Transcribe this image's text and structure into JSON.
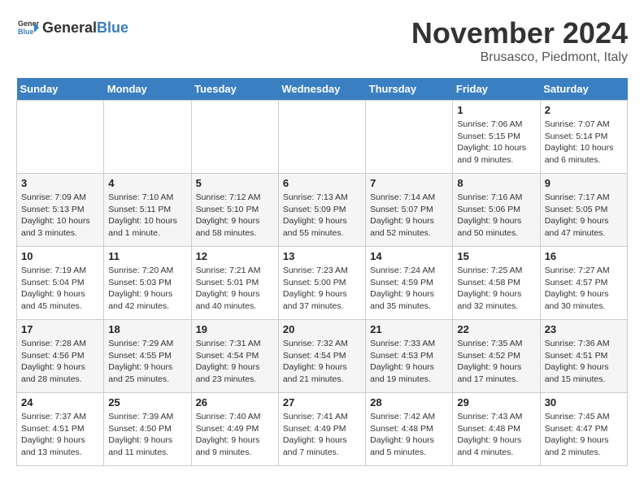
{
  "logo": {
    "text_general": "General",
    "text_blue": "Blue"
  },
  "header": {
    "month_title": "November 2024",
    "location": "Brusasco, Piedmont, Italy"
  },
  "weekdays": [
    "Sunday",
    "Monday",
    "Tuesday",
    "Wednesday",
    "Thursday",
    "Friday",
    "Saturday"
  ],
  "weeks": [
    [
      {
        "day": "",
        "detail": ""
      },
      {
        "day": "",
        "detail": ""
      },
      {
        "day": "",
        "detail": ""
      },
      {
        "day": "",
        "detail": ""
      },
      {
        "day": "",
        "detail": ""
      },
      {
        "day": "1",
        "detail": "Sunrise: 7:06 AM\nSunset: 5:15 PM\nDaylight: 10 hours\nand 9 minutes."
      },
      {
        "day": "2",
        "detail": "Sunrise: 7:07 AM\nSunset: 5:14 PM\nDaylight: 10 hours\nand 6 minutes."
      }
    ],
    [
      {
        "day": "3",
        "detail": "Sunrise: 7:09 AM\nSunset: 5:13 PM\nDaylight: 10 hours\nand 3 minutes."
      },
      {
        "day": "4",
        "detail": "Sunrise: 7:10 AM\nSunset: 5:11 PM\nDaylight: 10 hours\nand 1 minute."
      },
      {
        "day": "5",
        "detail": "Sunrise: 7:12 AM\nSunset: 5:10 PM\nDaylight: 9 hours\nand 58 minutes."
      },
      {
        "day": "6",
        "detail": "Sunrise: 7:13 AM\nSunset: 5:09 PM\nDaylight: 9 hours\nand 55 minutes."
      },
      {
        "day": "7",
        "detail": "Sunrise: 7:14 AM\nSunset: 5:07 PM\nDaylight: 9 hours\nand 52 minutes."
      },
      {
        "day": "8",
        "detail": "Sunrise: 7:16 AM\nSunset: 5:06 PM\nDaylight: 9 hours\nand 50 minutes."
      },
      {
        "day": "9",
        "detail": "Sunrise: 7:17 AM\nSunset: 5:05 PM\nDaylight: 9 hours\nand 47 minutes."
      }
    ],
    [
      {
        "day": "10",
        "detail": "Sunrise: 7:19 AM\nSunset: 5:04 PM\nDaylight: 9 hours\nand 45 minutes."
      },
      {
        "day": "11",
        "detail": "Sunrise: 7:20 AM\nSunset: 5:03 PM\nDaylight: 9 hours\nand 42 minutes."
      },
      {
        "day": "12",
        "detail": "Sunrise: 7:21 AM\nSunset: 5:01 PM\nDaylight: 9 hours\nand 40 minutes."
      },
      {
        "day": "13",
        "detail": "Sunrise: 7:23 AM\nSunset: 5:00 PM\nDaylight: 9 hours\nand 37 minutes."
      },
      {
        "day": "14",
        "detail": "Sunrise: 7:24 AM\nSunset: 4:59 PM\nDaylight: 9 hours\nand 35 minutes."
      },
      {
        "day": "15",
        "detail": "Sunrise: 7:25 AM\nSunset: 4:58 PM\nDaylight: 9 hours\nand 32 minutes."
      },
      {
        "day": "16",
        "detail": "Sunrise: 7:27 AM\nSunset: 4:57 PM\nDaylight: 9 hours\nand 30 minutes."
      }
    ],
    [
      {
        "day": "17",
        "detail": "Sunrise: 7:28 AM\nSunset: 4:56 PM\nDaylight: 9 hours\nand 28 minutes."
      },
      {
        "day": "18",
        "detail": "Sunrise: 7:29 AM\nSunset: 4:55 PM\nDaylight: 9 hours\nand 25 minutes."
      },
      {
        "day": "19",
        "detail": "Sunrise: 7:31 AM\nSunset: 4:54 PM\nDaylight: 9 hours\nand 23 minutes."
      },
      {
        "day": "20",
        "detail": "Sunrise: 7:32 AM\nSunset: 4:54 PM\nDaylight: 9 hours\nand 21 minutes."
      },
      {
        "day": "21",
        "detail": "Sunrise: 7:33 AM\nSunset: 4:53 PM\nDaylight: 9 hours\nand 19 minutes."
      },
      {
        "day": "22",
        "detail": "Sunrise: 7:35 AM\nSunset: 4:52 PM\nDaylight: 9 hours\nand 17 minutes."
      },
      {
        "day": "23",
        "detail": "Sunrise: 7:36 AM\nSunset: 4:51 PM\nDaylight: 9 hours\nand 15 minutes."
      }
    ],
    [
      {
        "day": "24",
        "detail": "Sunrise: 7:37 AM\nSunset: 4:51 PM\nDaylight: 9 hours\nand 13 minutes."
      },
      {
        "day": "25",
        "detail": "Sunrise: 7:39 AM\nSunset: 4:50 PM\nDaylight: 9 hours\nand 11 minutes."
      },
      {
        "day": "26",
        "detail": "Sunrise: 7:40 AM\nSunset: 4:49 PM\nDaylight: 9 hours\nand 9 minutes."
      },
      {
        "day": "27",
        "detail": "Sunrise: 7:41 AM\nSunset: 4:49 PM\nDaylight: 9 hours\nand 7 minutes."
      },
      {
        "day": "28",
        "detail": "Sunrise: 7:42 AM\nSunset: 4:48 PM\nDaylight: 9 hours\nand 5 minutes."
      },
      {
        "day": "29",
        "detail": "Sunrise: 7:43 AM\nSunset: 4:48 PM\nDaylight: 9 hours\nand 4 minutes."
      },
      {
        "day": "30",
        "detail": "Sunrise: 7:45 AM\nSunset: 4:47 PM\nDaylight: 9 hours\nand 2 minutes."
      }
    ]
  ]
}
